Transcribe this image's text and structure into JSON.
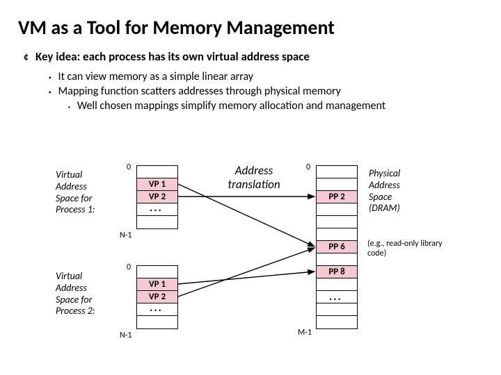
{
  "title": "VM as a Tool for Memory Management",
  "key_idea": "Key idea: each process has its own virtual address space",
  "sub1": "It can view memory as a simple linear array",
  "sub2": "Mapping function scatters addresses through physical memory",
  "sub3": "Well chosen mappings simplify memory allocation and management",
  "labels": {
    "vas1": "Virtual\nAddress\nSpace for\nProcess 1:",
    "vas2": "Virtual\nAddress\nSpace for\nProcess 2:",
    "at": "Address translation",
    "pas": "Physical\nAddress\nSpace\n(DRAM)",
    "note": "(e.g., read-only library code)"
  },
  "virtual_pages": {
    "vp1": "VP 1",
    "vp2": "VP 2"
  },
  "physical_pages": {
    "pp2": "PP 2",
    "pp6": "PP 6",
    "pp8": "PP 8"
  },
  "ticks": {
    "zero": "0",
    "n1": "N-1",
    "m1": "M-1"
  },
  "dots": "...",
  "chart_data": {
    "type": "table",
    "description": "Two virtual address spaces (Process 1 and Process 2), each indexed 0..N-1 containing pages VP1, VP2. A single physical address space (DRAM) indexed 0..M-1 containing pages PP2, PP6, PP8. Mapping arrows: P1.VP1 -> PP6, P1.VP2 -> PP2, P2.VP1 -> PP8, P2.VP2 -> PP6.",
    "mappings": [
      {
        "process": 1,
        "vp": "VP 1",
        "pp": "PP 6"
      },
      {
        "process": 1,
        "vp": "VP 2",
        "pp": "PP 2"
      },
      {
        "process": 2,
        "vp": "VP 1",
        "pp": "PP 8"
      },
      {
        "process": 2,
        "vp": "VP 2",
        "pp": "PP 6"
      }
    ]
  }
}
